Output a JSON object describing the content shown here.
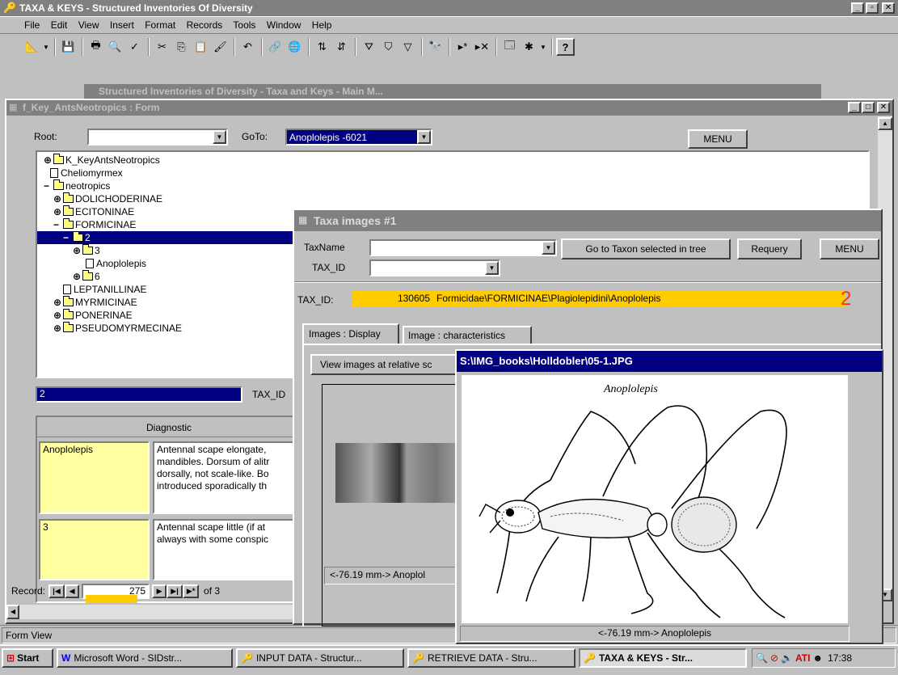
{
  "app": {
    "title": "TAXA & KEYS - Structured Inventories Of Diversity",
    "menu": [
      "File",
      "Edit",
      "View",
      "Insert",
      "Format",
      "Records",
      "Tools",
      "Window",
      "Help"
    ]
  },
  "key_form": {
    "title": "f_Key_AntsNeotropics : Form",
    "root_label": "Root:",
    "root_value": "",
    "goto_label": "GoTo:",
    "goto_value": "Anoplolepis -6021",
    "menu_button": "MENU",
    "tree": [
      {
        "label": "K_KeyAntsNeotropics",
        "exp": "+",
        "icon": "folder"
      },
      {
        "label": "Cheliomyrmex",
        "exp": "",
        "icon": "doc"
      },
      {
        "label": "neotropics",
        "exp": "−",
        "icon": "folder"
      },
      {
        "label": "DOLICHODERINAE",
        "exp": "+",
        "icon": "folder"
      },
      {
        "label": "ECITONINAE",
        "exp": "+",
        "icon": "folder"
      },
      {
        "label": "FORMICINAE",
        "exp": "−",
        "icon": "folder"
      },
      {
        "label": "2",
        "exp": "−",
        "icon": "folder",
        "selected": true
      },
      {
        "label": "3",
        "exp": "+",
        "icon": "folder"
      },
      {
        "label": "Anoplolepis",
        "exp": "",
        "icon": "doc"
      },
      {
        "label": "6",
        "exp": "+",
        "icon": "folder"
      },
      {
        "label": "LEPTANILLINAE",
        "exp": "",
        "icon": "doc"
      },
      {
        "label": "MYRMICINAE",
        "exp": "+",
        "icon": "folder"
      },
      {
        "label": "PONERINAE",
        "exp": "+",
        "icon": "folder"
      },
      {
        "label": "PSEUDOMYRMECINAE",
        "exp": "+",
        "icon": "folder"
      }
    ],
    "node_value": "2",
    "tax_id_label": "TAX_ID",
    "diagnostic_header": "Diagnostic",
    "rows": [
      {
        "name": "Anoplolepis",
        "text": "Antennal scape elongate, mandibles. Dorsum of alitr dorsally, not scale-like. Bo introduced sporadically th"
      },
      {
        "name": "3",
        "text": "Antennal scape little (if at always with some conspic"
      }
    ],
    "record_label": "Record:",
    "record_value": "275",
    "record_of": "of 3"
  },
  "behind_window_title": "Structured Inventories of Diversity - Taxa and Keys - Main M...",
  "taxa_images": {
    "title": "Taxa images #1",
    "taxname_label": "TaxName",
    "taxname_value": "",
    "goto_taxon_button": "Go to Taxon selected in tree",
    "requery_button": "Requery",
    "menu_button": "MENU",
    "tax_id_label": "TAX_ID",
    "tax_id_combo_value": "",
    "tax_id_label2": "TAX_ID:",
    "tax_id_value": "130605",
    "tax_path": "Formicidae\\FORMICINAE\\Plagiolepidini\\Anoplolepis",
    "level_number": "2",
    "tabs": [
      "Images : Display",
      "Image : characteristics"
    ],
    "view_button": "View images at relative sc",
    "caption": "<-76.19 mm-> Anoplol"
  },
  "image_viewer": {
    "title": "S:\\IMG_books\\Holldobler\\05-1.JPG",
    "image_label": "Anoplolepis",
    "caption": "<-76.19 mm-> Anoplolepis"
  },
  "status_bar": {
    "text": "Form View"
  },
  "taskbar": {
    "start": "Start",
    "items": [
      "Microsoft Word - SIDstr...",
      "INPUT DATA - Structur...",
      "RETRIEVE DATA - Stru...",
      "TAXA & KEYS - Str..."
    ],
    "clock": "17:38"
  },
  "colors": {
    "title_active": "#000080",
    "highlight_yellow": "#ffcc00",
    "level_number": "#ff3300"
  }
}
